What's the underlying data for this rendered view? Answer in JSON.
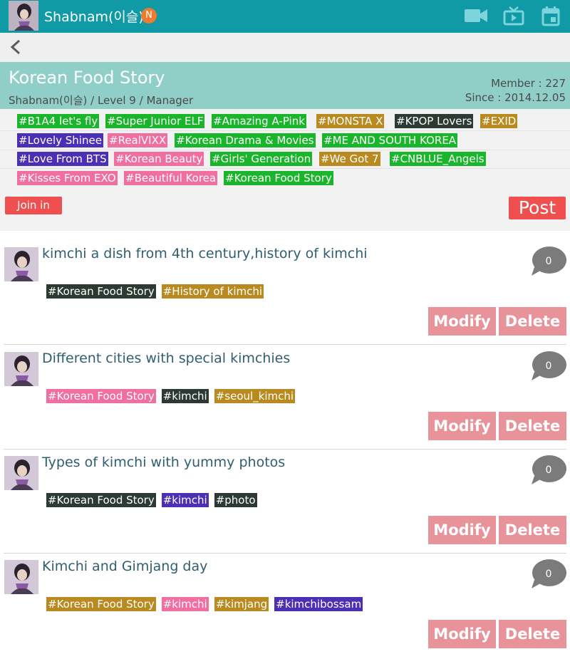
{
  "app": {
    "title": "Shabnam(이슬)",
    "badge": "N",
    "icons": [
      "video-icon",
      "tv-icon",
      "calendar-icon"
    ]
  },
  "nav": {
    "back_icon": "chevron-left-icon"
  },
  "community": {
    "name": "Korean Food Story",
    "owner_line": "Shabnam(이슬) / Level 9 / Manager",
    "member": "Member : 227",
    "since": "Since : 2014.12.05"
  },
  "tags": [
    {
      "label": "#B1A4 let's fly",
      "color": "#19b52b"
    },
    {
      "label": "#Super Junior ELF",
      "color": "#19b52b"
    },
    {
      "label": "#Amazing A-Pink",
      "color": "#19b52b"
    },
    {
      "label": "#MONSTA X",
      "color": "#b88a1f"
    },
    {
      "label": "#KPOP Lovers",
      "color": "#2c3a33"
    },
    {
      "label": "#EXID",
      "color": "#b88a1f"
    },
    {
      "label": "#Lovely Shinee",
      "color": "#4b2fb5"
    },
    {
      "label": "#RealVIXX",
      "color": "#f06fa0"
    },
    {
      "label": "#Korean Drama & Movies",
      "color": "#19b52b"
    },
    {
      "label": "#ME AND SOUTH KOREA",
      "color": "#19b52b"
    },
    {
      "label": "#Love From BTS",
      "color": "#4b2fb5"
    },
    {
      "label": "#Korean Beauty",
      "color": "#f06fa0"
    },
    {
      "label": "#Girls' Generation",
      "color": "#19b52b"
    },
    {
      "label": "#We Got 7",
      "color": "#b88a1f"
    },
    {
      "label": "#CNBLUE_Angels",
      "color": "#19b52b"
    },
    {
      "label": "#Kisses From EXO",
      "color": "#f06fa0"
    },
    {
      "label": "#Beautiful Korea",
      "color": "#f06fa0"
    },
    {
      "label": "#Korean Food Story",
      "color": "#19b52b"
    }
  ],
  "actions": {
    "join": "Join in",
    "post": "Post"
  },
  "posts": [
    {
      "title": "kimchi a dish from 4th century,history of kimchi",
      "comments": "0",
      "tags": [
        {
          "label": "#Korean Food Story",
          "color": "#2c3a33"
        },
        {
          "label": "#History of kimchi",
          "color": "#b88a1f"
        }
      ],
      "modify": "Modify",
      "delete": "Delete"
    },
    {
      "title": "Different cities with special kimchies",
      "comments": "0",
      "tags": [
        {
          "label": "#Korean Food Story",
          "color": "#f06fa0"
        },
        {
          "label": "#kimchi",
          "color": "#2c3a33"
        },
        {
          "label": "#seoul_kimchi",
          "color": "#b88a1f"
        }
      ],
      "modify": "Modify",
      "delete": "Delete"
    },
    {
      "title": "Types of kimchi with yummy photos",
      "comments": "0",
      "tags": [
        {
          "label": "#Korean Food Story",
          "color": "#2c3a33"
        },
        {
          "label": "#kimchi",
          "color": "#4b2fb5"
        },
        {
          "label": "#photo",
          "color": "#2c3a33"
        }
      ],
      "modify": "Modify",
      "delete": "Delete"
    },
    {
      "title": "Kimchi and Gimjang day",
      "comments": "0",
      "tags": [
        {
          "label": "#Korean Food Story",
          "color": "#b88a1f"
        },
        {
          "label": "#kimchi",
          "color": "#f06fa0"
        },
        {
          "label": "#kimjang",
          "color": "#b88a1f"
        },
        {
          "label": "#kimchibossam",
          "color": "#4b2fb5"
        }
      ],
      "modify": "Modify",
      "delete": "Delete"
    }
  ]
}
